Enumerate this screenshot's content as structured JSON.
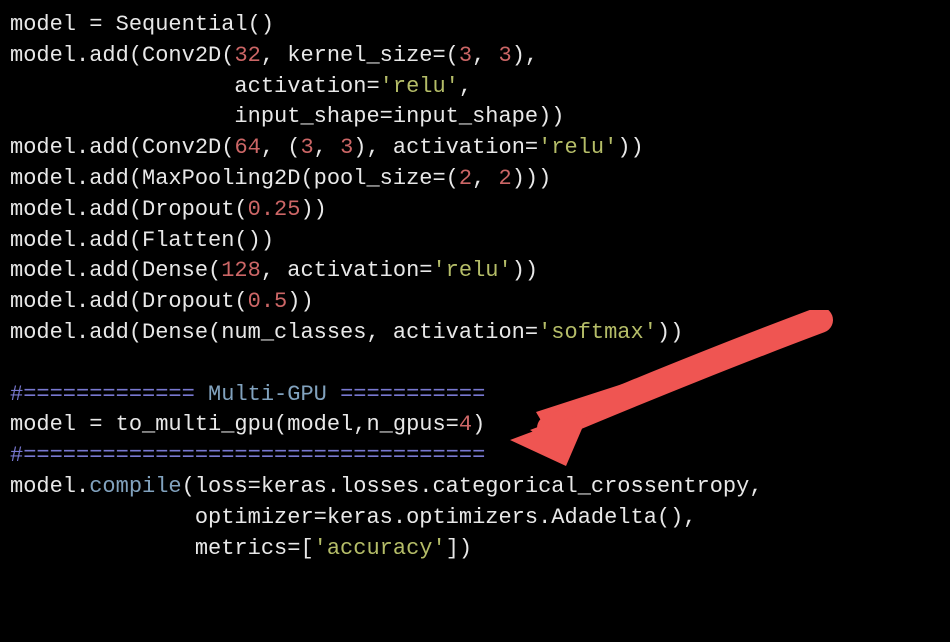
{
  "code": {
    "lines": [
      {
        "segments": [
          {
            "t": "model = Sequential()",
            "c": "w"
          }
        ]
      },
      {
        "segments": [
          {
            "t": "model.add(Conv2D(",
            "c": "w"
          },
          {
            "t": "32",
            "c": "n"
          },
          {
            "t": ", kernel_size=(",
            "c": "w"
          },
          {
            "t": "3",
            "c": "n"
          },
          {
            "t": ", ",
            "c": "w"
          },
          {
            "t": "3",
            "c": "n"
          },
          {
            "t": "),",
            "c": "w"
          }
        ]
      },
      {
        "segments": [
          {
            "t": "                 activation=",
            "c": "w"
          },
          {
            "t": "'relu'",
            "c": "str"
          },
          {
            "t": ",",
            "c": "w"
          }
        ]
      },
      {
        "segments": [
          {
            "t": "                 input_shape=input_shape))",
            "c": "w"
          }
        ]
      },
      {
        "segments": [
          {
            "t": "model.add(Conv2D(",
            "c": "w"
          },
          {
            "t": "64",
            "c": "n"
          },
          {
            "t": ", (",
            "c": "w"
          },
          {
            "t": "3",
            "c": "n"
          },
          {
            "t": ", ",
            "c": "w"
          },
          {
            "t": "3",
            "c": "n"
          },
          {
            "t": "), activation=",
            "c": "w"
          },
          {
            "t": "'relu'",
            "c": "str"
          },
          {
            "t": "))",
            "c": "w"
          }
        ]
      },
      {
        "segments": [
          {
            "t": "model.add(MaxPooling2D(pool_size=(",
            "c": "w"
          },
          {
            "t": "2",
            "c": "n"
          },
          {
            "t": ", ",
            "c": "w"
          },
          {
            "t": "2",
            "c": "n"
          },
          {
            "t": ")))",
            "c": "w"
          }
        ]
      },
      {
        "segments": [
          {
            "t": "model.add(Dropout(",
            "c": "w"
          },
          {
            "t": "0.25",
            "c": "n"
          },
          {
            "t": "))",
            "c": "w"
          }
        ]
      },
      {
        "segments": [
          {
            "t": "model.add(Flatten())",
            "c": "w"
          }
        ]
      },
      {
        "segments": [
          {
            "t": "model.add(Dense(",
            "c": "w"
          },
          {
            "t": "128",
            "c": "n"
          },
          {
            "t": ", activation=",
            "c": "w"
          },
          {
            "t": "'relu'",
            "c": "str"
          },
          {
            "t": "))",
            "c": "w"
          }
        ]
      },
      {
        "segments": [
          {
            "t": "model.add(Dropout(",
            "c": "w"
          },
          {
            "t": "0.5",
            "c": "n"
          },
          {
            "t": "))",
            "c": "w"
          }
        ]
      },
      {
        "segments": [
          {
            "t": "model.add(Dense(num_classes, activation=",
            "c": "w"
          },
          {
            "t": "'softmax'",
            "c": "str"
          },
          {
            "t": "))",
            "c": "w"
          }
        ]
      },
      {
        "segments": []
      },
      {
        "segments": [
          {
            "t": "#=============",
            "c": "comment"
          },
          {
            "t": " Multi-GPU ",
            "c": "call"
          },
          {
            "t": "===========",
            "c": "comment"
          }
        ]
      },
      {
        "segments": [
          {
            "t": "model = to_multi_gpu(model,n_gpus=",
            "c": "w"
          },
          {
            "t": "4",
            "c": "n"
          },
          {
            "t": ")",
            "c": "w"
          }
        ]
      },
      {
        "segments": [
          {
            "t": "#===================================",
            "c": "comment"
          }
        ]
      },
      {
        "segments": [
          {
            "t": "model.",
            "c": "w"
          },
          {
            "t": "compile",
            "c": "call"
          },
          {
            "t": "(loss=keras.losses.categorical_crossentropy,",
            "c": "w"
          }
        ]
      },
      {
        "segments": [
          {
            "t": "              optimizer=keras.optimizers.Adadelta(),",
            "c": "w"
          }
        ]
      },
      {
        "segments": [
          {
            "t": "              metrics=[",
            "c": "w"
          },
          {
            "t": "'accuracy'",
            "c": "str"
          },
          {
            "t": "])",
            "c": "w"
          }
        ]
      }
    ]
  },
  "annotation": {
    "arrow_target": "multi-gpu-line"
  }
}
